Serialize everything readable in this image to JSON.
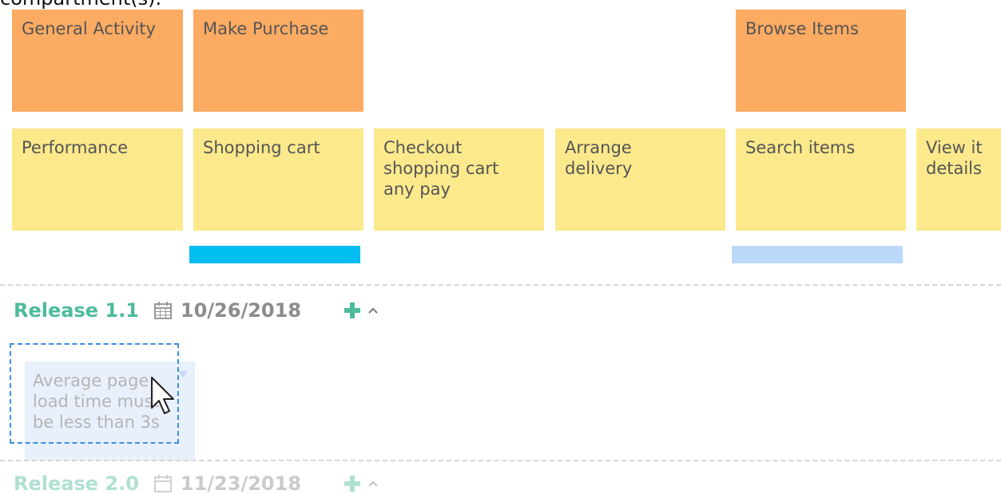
{
  "header_text": "compartment(s).",
  "activities": [
    {
      "label": "General Activity"
    },
    {
      "label": "Make Purchase"
    },
    {
      "label": "Browse Items"
    }
  ],
  "tasks": [
    {
      "label": "Performance"
    },
    {
      "label": "Shopping cart"
    },
    {
      "label": "Checkout\nshopping cart\nany pay"
    },
    {
      "label": "Arrange\ndelivery"
    },
    {
      "label": "Search items"
    },
    {
      "label": "View it\ndetails"
    }
  ],
  "bars": {
    "make_purchase_color": "#00bdf2",
    "browse_items_color": "#bcd9fb"
  },
  "releases": [
    {
      "name": "Release 1.1",
      "date": "10/26/2018"
    },
    {
      "name": "Release 2.0",
      "date": "11/23/2018"
    }
  ],
  "dragged_card": {
    "label": "Average page\nload time must\nbe less than 3s"
  },
  "colors": {
    "activity": "#fbab62",
    "task": "#fbe98c",
    "release_name": "#4dbb9c",
    "drop_zone_border": "#3b8fe0"
  }
}
